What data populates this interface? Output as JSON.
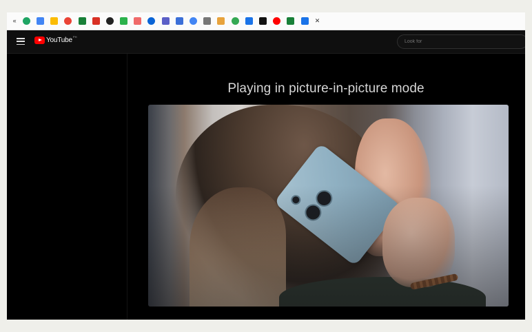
{
  "bookmarks": [
    {
      "name": "bookmark-text-icon",
      "text": "«"
    },
    {
      "name": "drive-icon",
      "color": "#1fa463"
    },
    {
      "name": "calendar-icon",
      "color": "#4285f4"
    },
    {
      "name": "keep-icon",
      "color": "#fbbc04"
    },
    {
      "name": "photos-icon",
      "color": "#ea4335"
    },
    {
      "name": "sheets-icon",
      "color": "#188038"
    },
    {
      "name": "record-icon",
      "color": "#d93025"
    },
    {
      "name": "github-icon",
      "color": "#222222"
    },
    {
      "name": "feedly-icon",
      "color": "#2bb24c"
    },
    {
      "name": "asana-icon",
      "color": "#f06a6a"
    },
    {
      "name": "outlook-icon",
      "color": "#0a64d6"
    },
    {
      "name": "teams-icon",
      "color": "#5b5fc7"
    },
    {
      "name": "settings-cog-icon",
      "color": "#3b6fd8"
    },
    {
      "name": "chrome-icon",
      "color": "#4285f4"
    },
    {
      "name": "globe-icon",
      "color": "#777777"
    },
    {
      "name": "link-icon",
      "color": "#e8a33d"
    },
    {
      "name": "trend-icon",
      "color": "#34a853"
    },
    {
      "name": "search-icon",
      "color": "#1a73e8"
    },
    {
      "name": "tiktok-icon",
      "color": "#111111"
    },
    {
      "name": "youtube-icon",
      "color": "#ff0000"
    },
    {
      "name": "grid-icon",
      "color": "#188038"
    },
    {
      "name": "dots-icon",
      "color": "#1a73e8"
    },
    {
      "name": "close-icon",
      "text": "✕"
    }
  ],
  "masthead": {
    "logo_text": "YouTube",
    "logo_sup": "PH",
    "search_placeholder": "Look for"
  },
  "player": {
    "message": "Playing in picture-in-picture mode"
  },
  "colors": {
    "background": "#000000",
    "masthead": "#0f0f0f",
    "brand": "#ff0000"
  }
}
